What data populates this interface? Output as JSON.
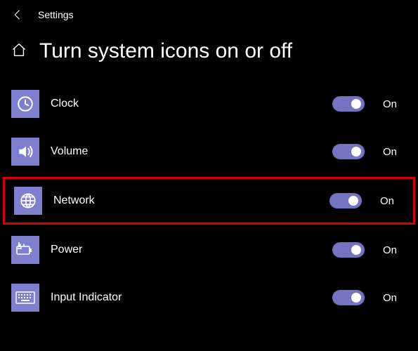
{
  "app_name": "Settings",
  "page_title": "Turn system icons on or off",
  "items": [
    {
      "label": "Clock",
      "state": "On",
      "highlighted": false
    },
    {
      "label": "Volume",
      "state": "On",
      "highlighted": false
    },
    {
      "label": "Network",
      "state": "On",
      "highlighted": true
    },
    {
      "label": "Power",
      "state": "On",
      "highlighted": false
    },
    {
      "label": "Input Indicator",
      "state": "On",
      "highlighted": false
    }
  ]
}
